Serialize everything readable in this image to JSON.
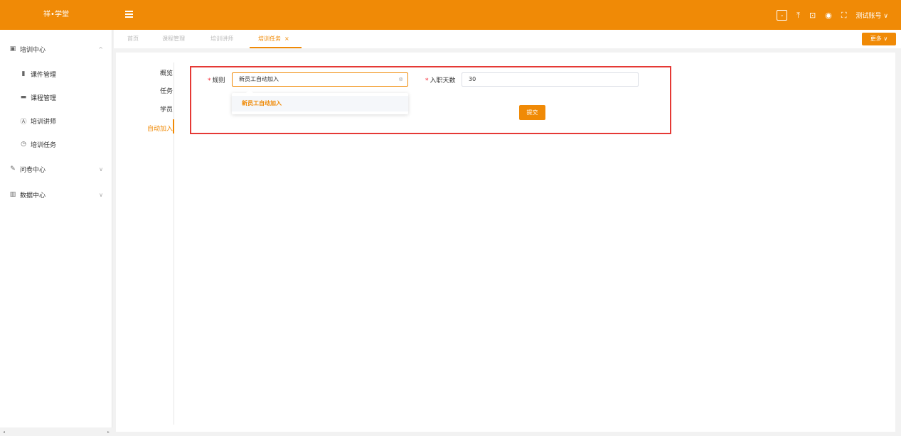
{
  "app": {
    "logo": "祥•学堂"
  },
  "header": {
    "user_label": "测试账号 ∨"
  },
  "sidebar": {
    "training_center": "培训中心",
    "courseware": "课件管理",
    "course": "课程管理",
    "lecturer": "培训讲师",
    "task": "培训任务",
    "survey_center": "问卷中心",
    "data_center": "数据中心"
  },
  "tabs": [
    "首页",
    "课程管理",
    "培训讲师",
    "培训任务"
  ],
  "tab_close": "×",
  "more_label": "更多 ∨",
  "subnav": [
    "概览",
    "任务",
    "学员",
    "自动加入"
  ],
  "form": {
    "rule_label": "规则",
    "rule_value": "新员工自动加入",
    "days_label": "入职天数",
    "days_value": "30",
    "dropdown_option": "新员工自动加入",
    "submit_label": "提交"
  }
}
